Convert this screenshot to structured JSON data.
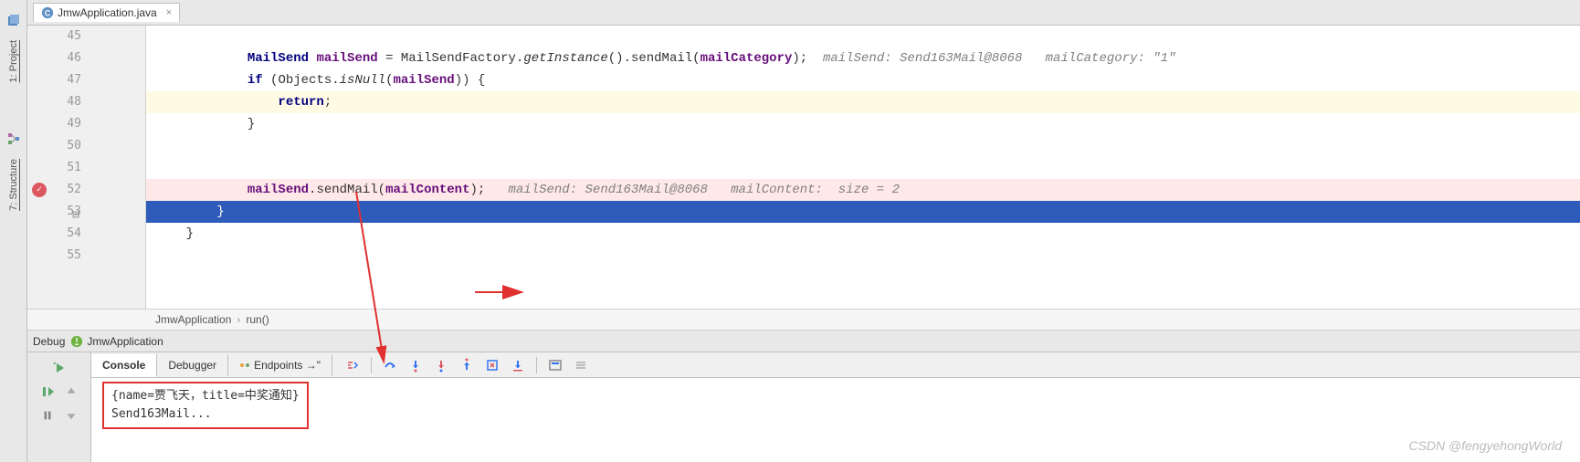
{
  "sidebar": {
    "project_label": "1: Project",
    "structure_label": "7: Structure"
  },
  "tab": {
    "filename": "JmwApplication.java"
  },
  "gutter": {
    "lines": [
      "45",
      "46",
      "47",
      "48",
      "49",
      "50",
      "51",
      "52",
      "53",
      "54",
      "55"
    ]
  },
  "code": {
    "line46_type": "MailSend ",
    "line46_var": "mailSend",
    "line46_assign": " = MailSendFactory.",
    "line46_method": "getInstance",
    "line46_call": "().sendMail(",
    "line46_param": "mailCategory",
    "line46_end": ");",
    "line46_hint": "  mailSend: Send163Mail@8068   mailCategory: \"1\"",
    "line47_if": "if",
    "line47_cond": " (Objects.",
    "line47_method": "isNull",
    "line47_open": "(",
    "line47_param": "mailSend",
    "line47_close": ")) {",
    "line48_return": "return",
    "line48_semi": ";",
    "line49_brace": "}",
    "line52_var": "mailSend",
    "line52_call": ".sendMail(",
    "line52_param": "mailContent",
    "line52_end": ");",
    "line52_hint": "   mailSend: Send163Mail@8068   mailContent:  size = 2",
    "line53_brace": "    }",
    "line54_brace": "}"
  },
  "breadcrumb": {
    "class": "JmwApplication",
    "method": "run()"
  },
  "debug": {
    "label": "Debug",
    "config": "JmwApplication",
    "tabs": {
      "console": "Console",
      "debugger": "Debugger",
      "endpoints": "Endpoints",
      "arrow": "→\""
    }
  },
  "console": {
    "line1": "{name=贾飞天，title=中奖通知}",
    "line2": "Send163Mail..."
  },
  "watermark": "CSDN @fengyehongWorld"
}
